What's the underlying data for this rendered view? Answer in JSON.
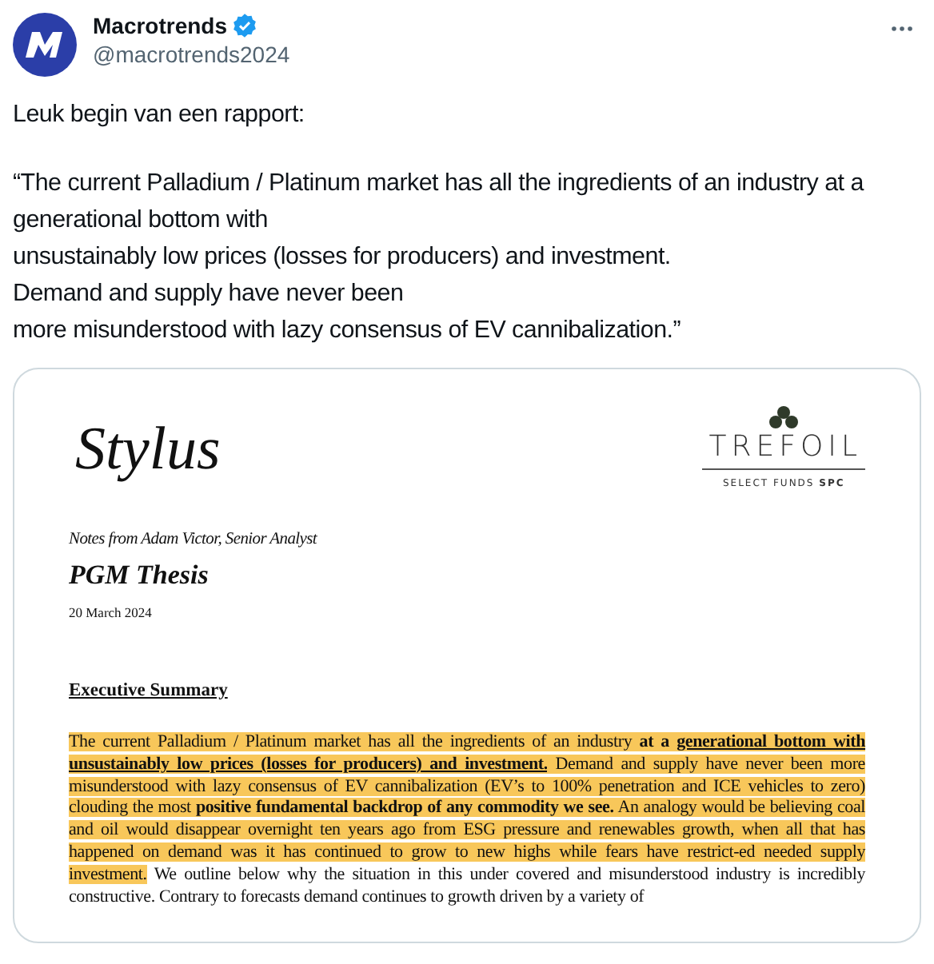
{
  "author": {
    "name": "Macrotrends",
    "verified": true,
    "handle": "@macrotrends2024"
  },
  "tweet_text": [
    "Leuk begin van een rapport:",
    "“The current Palladium / Platinum market has all the ingredients of an industry at a generational bottom with\nunsustainably low prices (losses for producers) and investment.\nDemand and supply have never been\nmore misunderstood with lazy consensus of EV cannibalization.”"
  ],
  "document": {
    "signature": "Stylus",
    "brand": "TREFOIL",
    "brand_sub": "SELECT FUNDS **SPC**",
    "byline": "Notes from Adam Victor, Senior Analyst",
    "title": "PGM Thesis",
    "date": "20 March 2024",
    "heading": "Executive Summary",
    "paragraph": [
      {
        "text": "The current Palladium / Platinum market has all the ingredients of an industry ",
        "kind": "plain",
        "highlight": true
      },
      {
        "text": "at a ",
        "kind": "bold",
        "highlight": true
      },
      {
        "text": "generational bottom with unsustainably low prices (losses for producers) and investment.",
        "kind": "bold_underline",
        "highlight": true
      },
      {
        "text": " Demand and supply have never been more misunderstood with lazy consensus of EV cannibalization (EV’s to 100% penetration and ICE vehicles to zero) clouding the most ",
        "kind": "plain",
        "highlight": true
      },
      {
        "text": "positive fundamental backdrop of any commodity we see.",
        "kind": "bold",
        "highlight": true
      },
      {
        "text": " An analogy would be believing coal and oil would disappear overnight ten years ago from ESG pressure and renewables growth, when all that has happened on demand was it has continued to grow to new highs while fears have restrict-ed needed supply investment.",
        "kind": "plain",
        "highlight": true
      },
      {
        "text": " We outline below why the situation in this under covered and misunderstood industry is incredibly constructive.  Contrary to forecasts demand continues to growth driven by a variety of",
        "kind": "plain",
        "highlight": false
      }
    ]
  }
}
